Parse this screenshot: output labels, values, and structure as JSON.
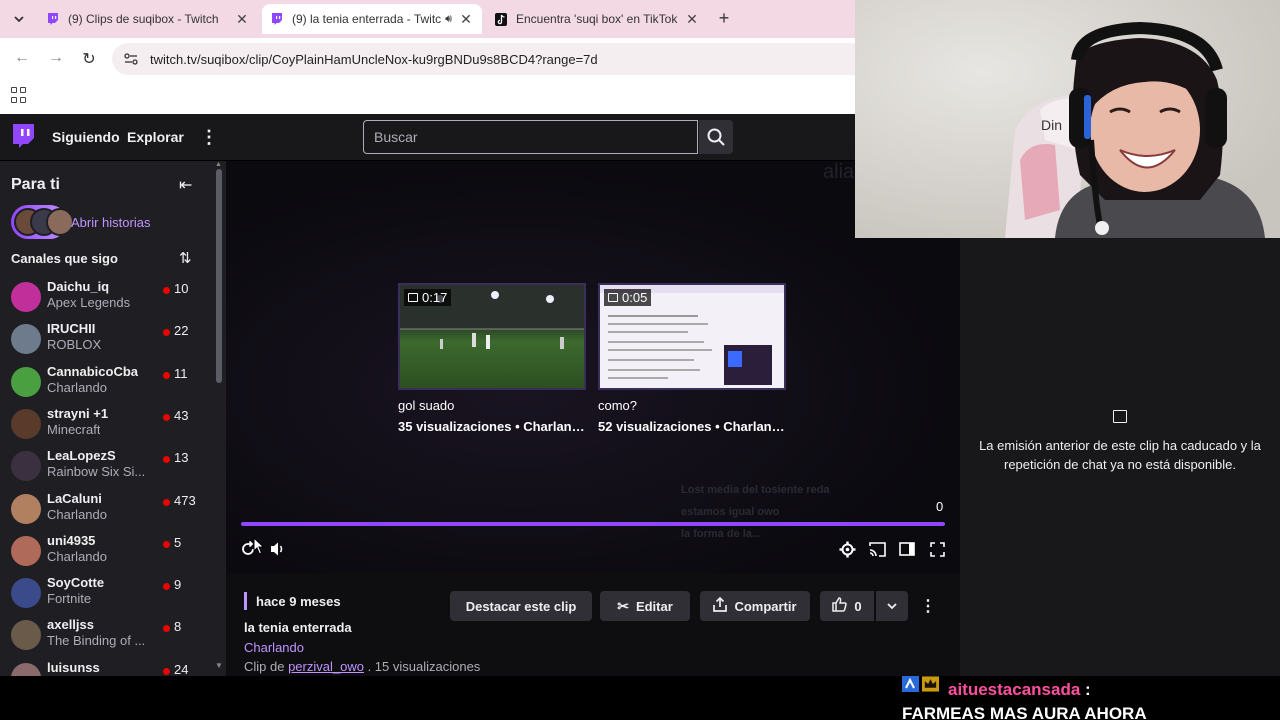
{
  "browser": {
    "tabs": [
      {
        "title": "(9) Clips de suqibox - Twitch",
        "active": false
      },
      {
        "title": "(9) la tenia enterrada - Twitch",
        "active": true
      },
      {
        "title": "Encuentra 'suqi box' en TikTok | Bus",
        "active": false
      }
    ],
    "url": "twitch.tv/suqibox/clip/CoyPlainHamUncleNox-ku9rgBNDu9s8BCD4?range=7d"
  },
  "twitch_nav": {
    "following": "Siguiendo",
    "explore": "Explorar",
    "search_placeholder": "Buscar"
  },
  "sidebar": {
    "title": "Para ti",
    "stories_label": "Abrir historias",
    "followed_label": "Canales que sigo",
    "channels": [
      {
        "name": "Daichu_iq",
        "game": "Apex Legends",
        "viewers": "10",
        "color": "#c02f9a"
      },
      {
        "name": "IRUCHII",
        "game": "ROBLOX",
        "viewers": "22",
        "color": "#6d7b8c"
      },
      {
        "name": "CannabicoCba",
        "game": "Charlando",
        "viewers": "11",
        "color": "#4aa040"
      },
      {
        "name": "strayni +1",
        "game": "Minecraft",
        "viewers": "43",
        "color": "#5a3a2a"
      },
      {
        "name": "LeaLopezS",
        "game": "Rainbow Six Si...",
        "viewers": "13",
        "color": "#3a3040"
      },
      {
        "name": "LaCaluni",
        "game": "Charlando",
        "viewers": "473",
        "color": "#b08060"
      },
      {
        "name": "uni4935",
        "game": "Charlando",
        "viewers": "5",
        "color": "#b06a5a"
      },
      {
        "name": "SoyCotte",
        "game": "Fortnite",
        "viewers": "9",
        "color": "#3a4a8a"
      },
      {
        "name": "axelljss",
        "game": "The Binding of ...",
        "viewers": "8",
        "color": "#6a5a4a"
      },
      {
        "name": "luisunss",
        "game": "",
        "viewers": "24",
        "color": "#8a6a6a"
      }
    ]
  },
  "player": {
    "recommended": [
      {
        "duration": "0:17",
        "title": "gol suado",
        "meta": "35 visualizaciones • Charlando"
      },
      {
        "duration": "0:05",
        "title": "como?",
        "meta": "52 visualizaciones • Charlando"
      }
    ],
    "counter": "0",
    "ghost_chat": [
      "Lost media del tosiente reda",
      "estamos igual owo",
      "la forma de la..."
    ]
  },
  "clip_info": {
    "ago": "hace 9 meses",
    "title": "la tenia enterrada",
    "category": "Charlando",
    "by_prefix": "Clip de ",
    "author": "perzival_owo",
    "views": " . 15 visualizaciones",
    "buttons": {
      "feature": "Destacar este clip",
      "edit": "Editar",
      "share": "Compartir",
      "likes": "0"
    }
  },
  "chat_panel": {
    "message": "La emisión anterior de este clip ha caducado y la repetición de chat ya no está disponible."
  },
  "webcam": {
    "sign_text": "Din"
  },
  "stream_overlay": {
    "username": "aituestacansada",
    "colon": " :",
    "message": "FARMEAS MAS AURA AHORA"
  }
}
